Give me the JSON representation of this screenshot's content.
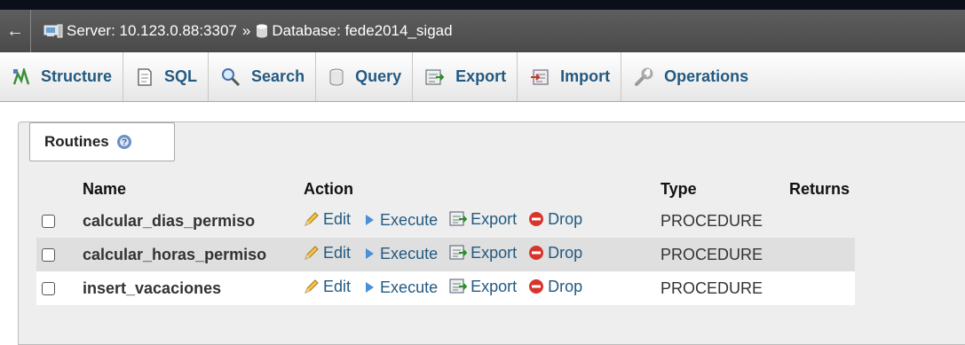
{
  "breadcrumb": {
    "back_icon": "left-arrow",
    "server_label": "Server: 10.123.0.88:3307",
    "separator": "»",
    "database_label": "Database: fede2014_sigad"
  },
  "tabs": [
    {
      "label": "Structure",
      "icon": "structure-icon"
    },
    {
      "label": "SQL",
      "icon": "sql-icon"
    },
    {
      "label": "Search",
      "icon": "search-icon"
    },
    {
      "label": "Query",
      "icon": "query-icon"
    },
    {
      "label": "Export",
      "icon": "export-icon"
    },
    {
      "label": "Import",
      "icon": "import-icon"
    },
    {
      "label": "Operations",
      "icon": "operations-icon"
    }
  ],
  "routines": {
    "legend": "Routines",
    "columns": {
      "name": "Name",
      "action": "Action",
      "type": "Type",
      "returns": "Returns"
    },
    "actions": {
      "edit": "Edit",
      "execute": "Execute",
      "export": "Export",
      "drop": "Drop"
    },
    "rows": [
      {
        "name": "calcular_dias_permiso",
        "type": "PROCEDURE",
        "returns": ""
      },
      {
        "name": "calcular_horas_permiso",
        "type": "PROCEDURE",
        "returns": ""
      },
      {
        "name": "insert_vacaciones",
        "type": "PROCEDURE",
        "returns": ""
      }
    ]
  },
  "colors": {
    "link": "#235a81",
    "breadcrumb_bg": "#505050",
    "drop_red": "#d9342b"
  }
}
